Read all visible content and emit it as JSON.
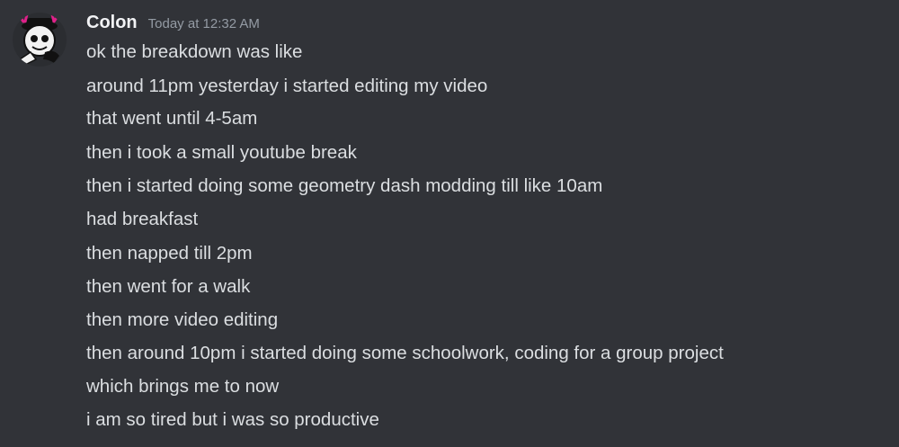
{
  "message": {
    "author": "Colon",
    "timestamp": "Today at 12:32 AM",
    "avatar_icon": "skull-character-avatar",
    "lines": [
      "ok the breakdown was like",
      "around 11pm yesterday i started editing my video",
      "that went until 4-5am",
      "then i took a small youtube break",
      "then i started doing some geometry dash modding till like 10am",
      "had breakfast",
      "then napped till 2pm",
      "then went for a walk",
      "then more video editing",
      "then around 10pm i started doing some schoolwork, coding for a group project",
      "which brings me to now",
      "i am so tired but i was so productive"
    ]
  },
  "colors": {
    "background": "#313338",
    "username": "#f2f3f5",
    "timestamp": "#949ba4",
    "text": "#dbdee1",
    "avatar_accent": "#e0218a"
  }
}
